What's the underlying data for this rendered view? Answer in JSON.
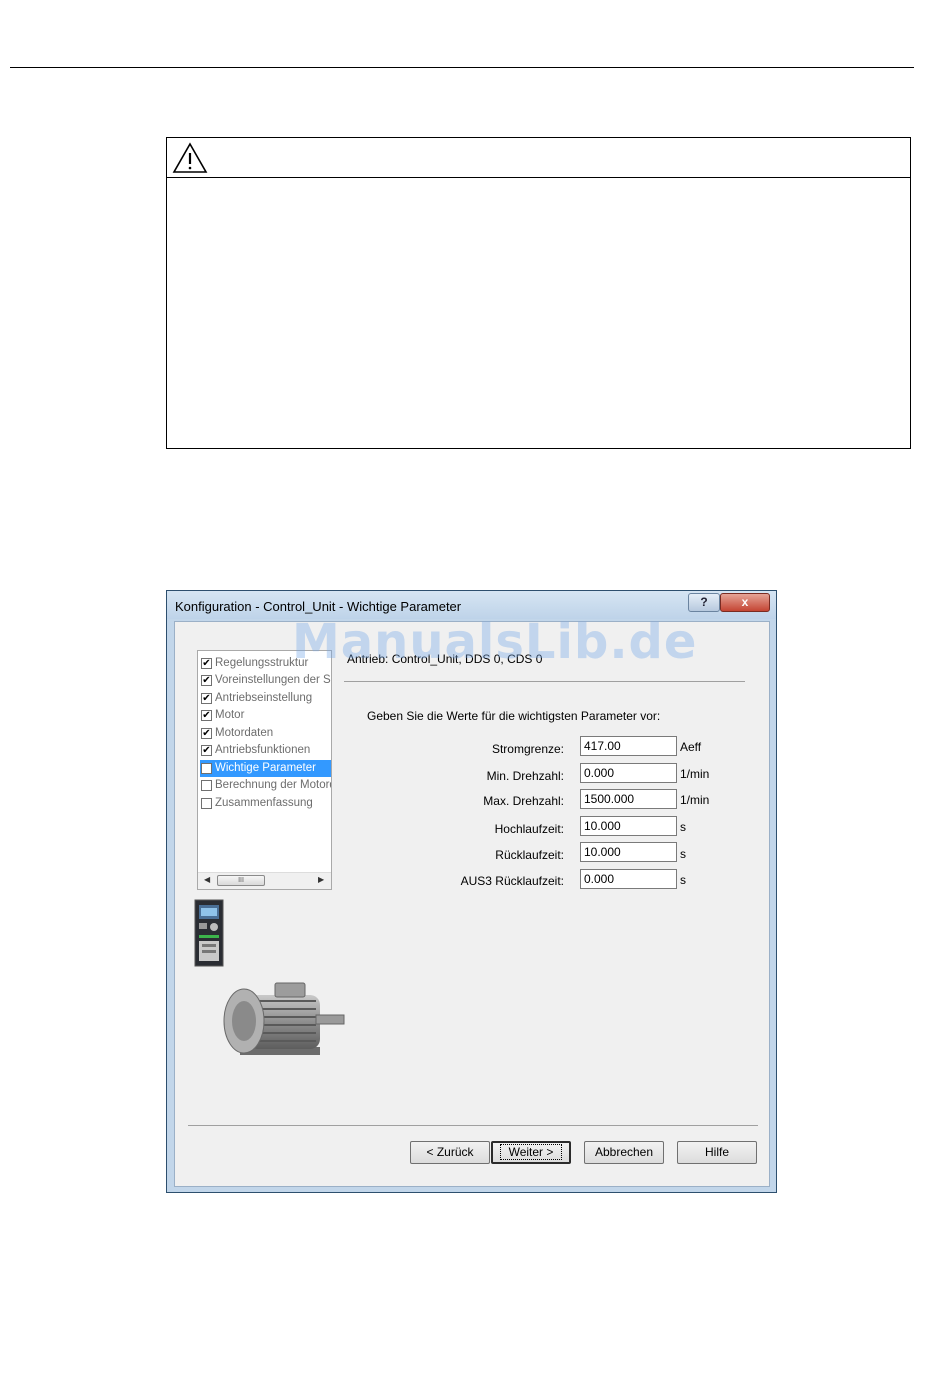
{
  "warning": {
    "icon": "warning-triangle-icon"
  },
  "watermark": "ManualsLib.de",
  "dialog": {
    "title": "Konfiguration - Control_Unit - Wichtige Parameter",
    "help_button": "?",
    "close_button": "x",
    "tree": {
      "items": [
        {
          "label": "Regelungsstruktur",
          "checked": true
        },
        {
          "label": "Voreinstellungen der Sollwerte",
          "checked": true
        },
        {
          "label": "Antriebseinstellung",
          "checked": true
        },
        {
          "label": "Motor",
          "checked": true
        },
        {
          "label": "Motordaten",
          "checked": true
        },
        {
          "label": "Antriebsfunktionen",
          "checked": true
        },
        {
          "label": "Wichtige Parameter",
          "checked": false,
          "selected": true
        },
        {
          "label": "Berechnung der Motordaten",
          "checked": false
        },
        {
          "label": "Zusammenfassung",
          "checked": false
        }
      ],
      "scroll_thumb": "III"
    },
    "drive_label": "Antrieb: Control_Unit, DDS 0, CDS 0",
    "instruction": "Geben Sie die Werte für die wichtigsten Parameter vor:",
    "parameters": [
      {
        "label": "Stromgrenze:",
        "value": "417.00",
        "unit": "Aeff"
      },
      {
        "label": "Min. Drehzahl:",
        "value": "0.000",
        "unit": "1/min"
      },
      {
        "label": "Max. Drehzahl:",
        "value": "1500.000",
        "unit": "1/min"
      },
      {
        "label": "Hochlaufzeit:",
        "value": "10.000",
        "unit": "s"
      },
      {
        "label": "Rücklaufzeit:",
        "value": "10.000",
        "unit": "s"
      },
      {
        "label": "AUS3 Rücklaufzeit:",
        "value": "0.000",
        "unit": "s"
      }
    ],
    "buttons": {
      "back": "< Zurück",
      "next": "Weiter >",
      "cancel": "Abbrechen",
      "help": "Hilfe"
    }
  }
}
